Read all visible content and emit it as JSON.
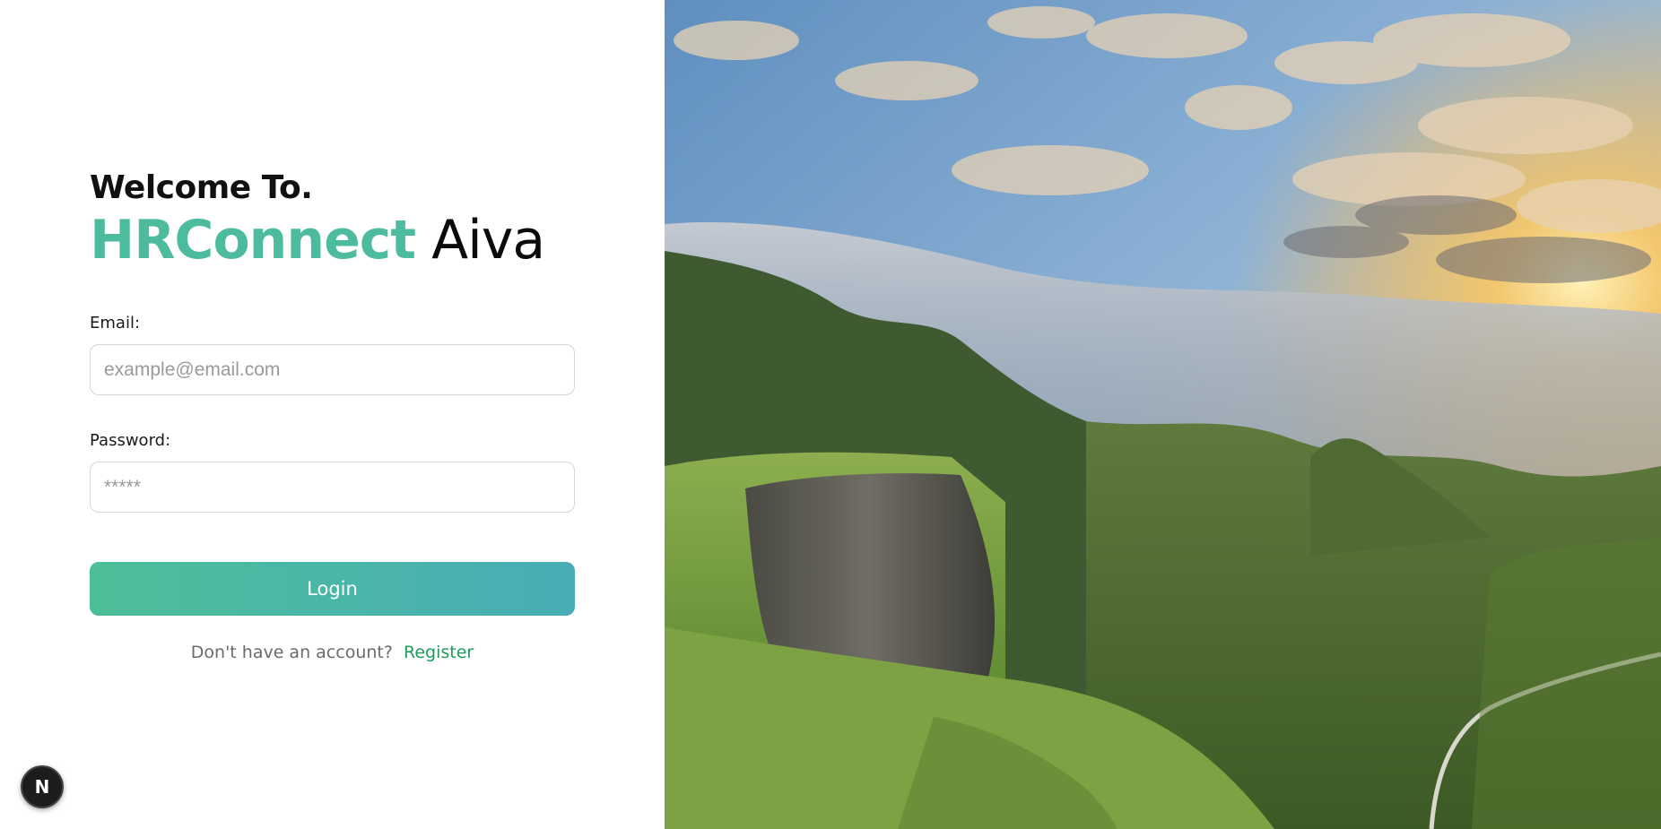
{
  "login": {
    "welcome": "Welcome To.",
    "brand_accent": "HRConnect",
    "brand_rest": "Aiva",
    "email_label": "Email:",
    "email_placeholder": "example@email.com",
    "password_label": "Password:",
    "password_placeholder": "*****",
    "login_label": "Login",
    "register_prompt": "Don't have an account?",
    "register_link": "Register"
  },
  "badge": {
    "label": "N"
  },
  "hero": {
    "icon": "landscape-photo"
  },
  "colors": {
    "accent": "#4dbb9e",
    "button_start": "#4cbf99",
    "button_end": "#48adb6",
    "link": "#1d9c5a"
  }
}
